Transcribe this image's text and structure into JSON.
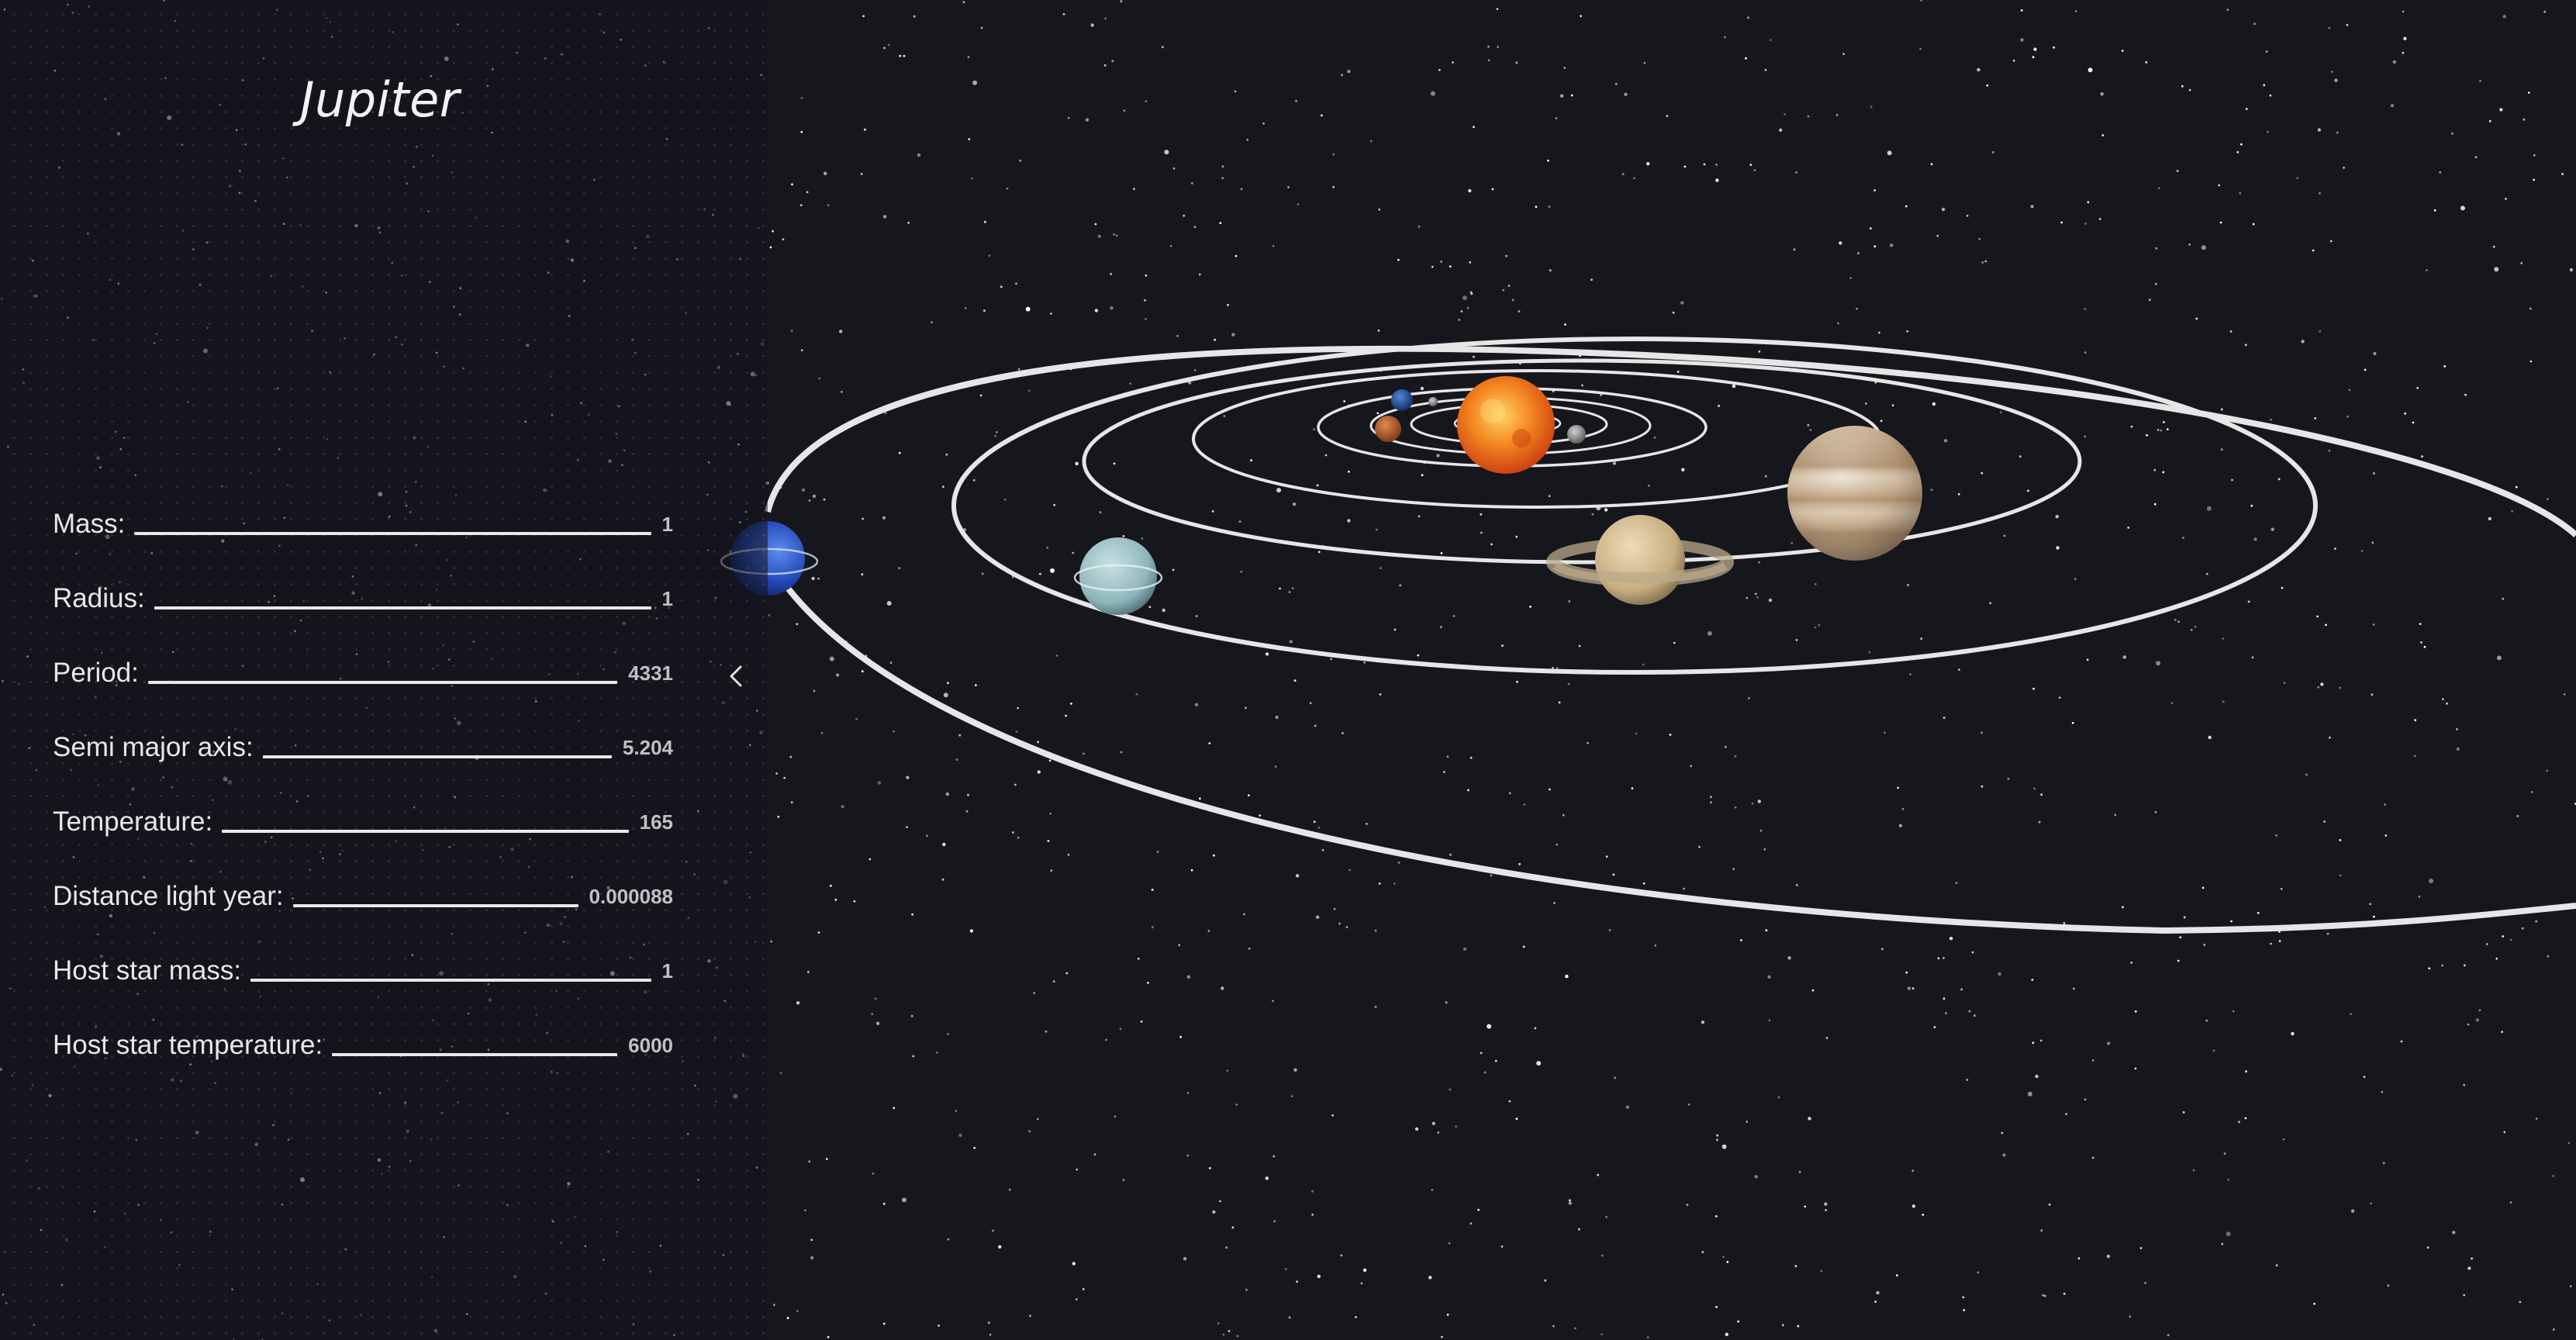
{
  "panel": {
    "title": "Jupiter",
    "properties": [
      {
        "label": "Mass:",
        "value": "1"
      },
      {
        "label": "Radius:",
        "value": "1"
      },
      {
        "label": "Period:",
        "value": "4331"
      },
      {
        "label": "Semi major axis:",
        "value": "5.204"
      },
      {
        "label": "Temperature:",
        "value": "165"
      },
      {
        "label": "Distance light year:",
        "value": "0.000088"
      },
      {
        "label": "Host star mass:",
        "value": "1"
      },
      {
        "label": "Host star temperature:",
        "value": "6000"
      }
    ],
    "collapse_icon": "chevron-left-icon"
  },
  "scene": {
    "background_color": "#16161d",
    "orbit_color": "#e6e6e6",
    "bodies": [
      {
        "name": "sun",
        "color": "#f07a1e"
      },
      {
        "name": "mercury",
        "color": "#9a9a9a"
      },
      {
        "name": "venus",
        "color": "#c9c9c9"
      },
      {
        "name": "earth",
        "color": "#2d5fb4"
      },
      {
        "name": "mars",
        "color": "#b4582a"
      },
      {
        "name": "jupiter",
        "color": "#cdb79a"
      },
      {
        "name": "saturn",
        "color": "#cdb489"
      },
      {
        "name": "uranus",
        "color": "#9fc4c9"
      },
      {
        "name": "neptune",
        "color": "#2f5fd0"
      }
    ]
  }
}
